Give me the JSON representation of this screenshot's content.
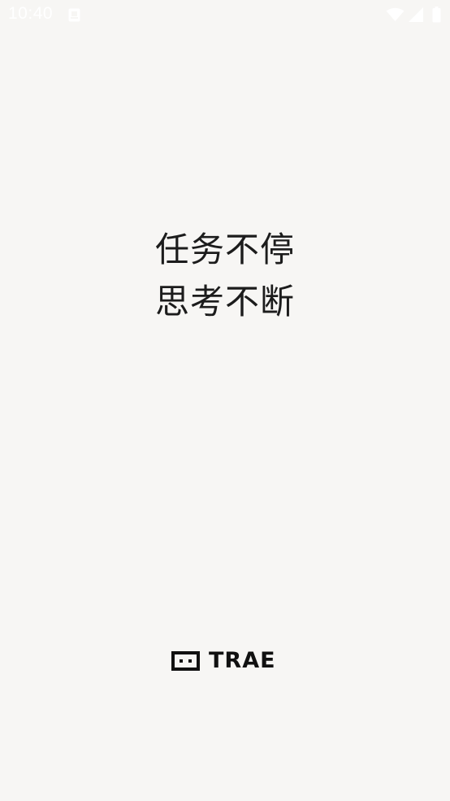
{
  "status_bar": {
    "time": "10:40",
    "icons": [
      "notification-icon",
      "wifi-icon",
      "signal-icon",
      "battery-icon"
    ]
  },
  "splash": {
    "line1": "任务不停",
    "line2": "思考不断"
  },
  "brand": {
    "name": "TRAE",
    "logo_icon": "trae-logo-icon"
  },
  "colors": {
    "background": "#f7f6f4",
    "text": "#1c1c1c",
    "brand": "#111111",
    "status_icons": "#ffffff"
  }
}
